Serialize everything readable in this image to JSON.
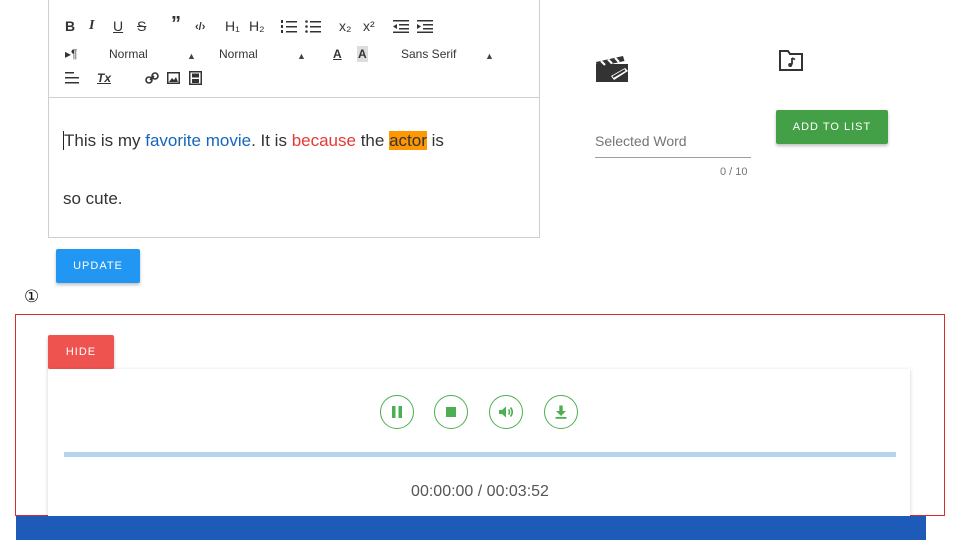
{
  "toolbar": {
    "bold": "B",
    "italic": "I",
    "underline": "U",
    "strike": "S",
    "blockquote": "”",
    "code": "‹/›",
    "h1": "H₁",
    "h2": "H₂",
    "subscript": "x₂",
    "superscript": "x²",
    "direction": "▸¶",
    "size_select": "Normal",
    "header_select": "Normal",
    "font_select": "Sans Serif",
    "clean": "Tx"
  },
  "editor": {
    "t1": "This is my ",
    "t2": "favorite movie",
    "t3": ". It is ",
    "t4": "because",
    "t5": " the ",
    "t6": "actor",
    "t7": " is",
    "t8": "so cute."
  },
  "buttons": {
    "update": "UPDATE",
    "add_to_list": "ADD TO LIST",
    "hide": "HIDE"
  },
  "word_field": {
    "label": "Selected Word",
    "counter": "0 / 10"
  },
  "marker": "①",
  "player": {
    "time": "00:00:00 / 00:03:52",
    "progress": 0
  },
  "colors": {
    "update": "#2196f3",
    "add": "#43a047",
    "hide": "#ef5350",
    "controls": "#4caf50",
    "link_blue": "#1565c0",
    "text_red": "#e53935",
    "highlight": "#ff9800"
  }
}
